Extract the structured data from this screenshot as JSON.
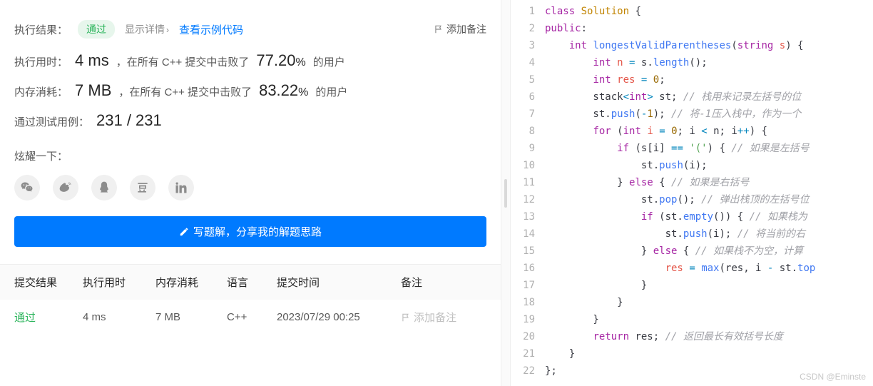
{
  "result": {
    "label": "执行结果：",
    "status": "通过",
    "show_detail": "显示详情",
    "view_example": "查看示例代码",
    "add_note": "添加备注"
  },
  "stats": {
    "time_label": "执行用时：",
    "time_value": "4 ms",
    "time_text1": "，在所有 C++ 提交中击败了",
    "time_pct": "77.20",
    "time_pct_sym": "%",
    "time_text2": "的用户",
    "mem_label": "内存消耗：",
    "mem_value": "7 MB",
    "mem_text1": "，在所有 C++ 提交中击败了",
    "mem_pct": "83.22",
    "mem_pct_sym": "%",
    "mem_text2": "的用户",
    "cases_label": "通过测试用例：",
    "cases_value": "231 / 231"
  },
  "share": {
    "label": "炫耀一下："
  },
  "button": {
    "write": "写题解，分享我的解题思路"
  },
  "table": {
    "headers": {
      "c1": "提交结果",
      "c2": "执行用时",
      "c3": "内存消耗",
      "c4": "语言",
      "c5": "提交时间",
      "c6": "备注"
    },
    "row": {
      "c1": "通过",
      "c2": "4 ms",
      "c3": "7 MB",
      "c4": "C++",
      "c5": "2023/07/29 00:25",
      "c6": "添加备注"
    }
  },
  "code": {
    "lines": [
      {
        "n": 1,
        "ind": 0,
        "tokens": [
          [
            "k-keyword",
            "class"
          ],
          [
            "",
            " "
          ],
          [
            "k-type",
            "Solution"
          ],
          [
            "",
            " {"
          ]
        ]
      },
      {
        "n": 2,
        "ind": 0,
        "tokens": [
          [
            "k-keyword",
            "public"
          ],
          [
            "",
            ":"
          ]
        ]
      },
      {
        "n": 3,
        "ind": 1,
        "tokens": [
          [
            "k-keyword",
            "int"
          ],
          [
            "",
            " "
          ],
          [
            "k-func",
            "longestValidParentheses"
          ],
          [
            "",
            "("
          ],
          [
            "k-keyword",
            "string"
          ],
          [
            "",
            " "
          ],
          [
            "k-ident",
            "s"
          ],
          [
            "",
            ") {"
          ]
        ]
      },
      {
        "n": 4,
        "ind": 2,
        "tokens": [
          [
            "k-keyword",
            "int"
          ],
          [
            "",
            " "
          ],
          [
            "k-ident",
            "n"
          ],
          [
            "",
            " "
          ],
          [
            "k-op",
            "="
          ],
          [
            "",
            " s."
          ],
          [
            "k-func",
            "length"
          ],
          [
            "",
            "();"
          ]
        ]
      },
      {
        "n": 5,
        "ind": 2,
        "tokens": [
          [
            "k-keyword",
            "int"
          ],
          [
            "",
            " "
          ],
          [
            "k-ident",
            "res"
          ],
          [
            "",
            " "
          ],
          [
            "k-op",
            "="
          ],
          [
            "",
            " "
          ],
          [
            "k-num",
            "0"
          ],
          [
            "",
            ";"
          ]
        ]
      },
      {
        "n": 6,
        "ind": 2,
        "tokens": [
          [
            "",
            "stack"
          ],
          [
            "k-op",
            "<"
          ],
          [
            "k-keyword",
            "int"
          ],
          [
            "k-op",
            ">"
          ],
          [
            "",
            " st; "
          ],
          [
            "k-comment",
            "// 栈用来记录左括号的位"
          ]
        ]
      },
      {
        "n": 7,
        "ind": 2,
        "tokens": [
          [
            "",
            "st."
          ],
          [
            "k-func",
            "push"
          ],
          [
            "",
            "("
          ],
          [
            "k-op",
            "-"
          ],
          [
            "k-num",
            "1"
          ],
          [
            "",
            "); "
          ],
          [
            "k-comment",
            "// 将-1压入栈中，作为一个"
          ]
        ]
      },
      {
        "n": 8,
        "ind": 2,
        "tokens": [
          [
            "k-keyword",
            "for"
          ],
          [
            "",
            " ("
          ],
          [
            "k-keyword",
            "int"
          ],
          [
            "",
            " "
          ],
          [
            "k-ident",
            "i"
          ],
          [
            "",
            " "
          ],
          [
            "k-op",
            "="
          ],
          [
            "",
            " "
          ],
          [
            "k-num",
            "0"
          ],
          [
            "",
            "; i "
          ],
          [
            "k-op",
            "<"
          ],
          [
            "",
            " n; i"
          ],
          [
            "k-op",
            "++"
          ],
          [
            "",
            ") {"
          ]
        ]
      },
      {
        "n": 9,
        "ind": 3,
        "tokens": [
          [
            "k-keyword",
            "if"
          ],
          [
            "",
            " (s[i] "
          ],
          [
            "k-op",
            "=="
          ],
          [
            "",
            " "
          ],
          [
            "k-str",
            "'('"
          ],
          [
            "",
            ") { "
          ],
          [
            "k-comment",
            "// 如果是左括号"
          ]
        ]
      },
      {
        "n": 10,
        "ind": 4,
        "tokens": [
          [
            "",
            "st."
          ],
          [
            "k-func",
            "push"
          ],
          [
            "",
            "(i);"
          ]
        ]
      },
      {
        "n": 11,
        "ind": 3,
        "tokens": [
          [
            "",
            "} "
          ],
          [
            "k-keyword",
            "else"
          ],
          [
            "",
            " { "
          ],
          [
            "k-comment",
            "// 如果是右括号"
          ]
        ]
      },
      {
        "n": 12,
        "ind": 4,
        "tokens": [
          [
            "",
            "st."
          ],
          [
            "k-func",
            "pop"
          ],
          [
            "",
            "(); "
          ],
          [
            "k-comment",
            "// 弹出栈顶的左括号位"
          ]
        ]
      },
      {
        "n": 13,
        "ind": 4,
        "tokens": [
          [
            "k-keyword",
            "if"
          ],
          [
            "",
            " (st."
          ],
          [
            "k-func",
            "empty"
          ],
          [
            "",
            "()) { "
          ],
          [
            "k-comment",
            "// 如果栈为"
          ]
        ]
      },
      {
        "n": 14,
        "ind": 5,
        "tokens": [
          [
            "",
            "st."
          ],
          [
            "k-func",
            "push"
          ],
          [
            "",
            "(i); "
          ],
          [
            "k-comment",
            "// 将当前的右"
          ]
        ]
      },
      {
        "n": 15,
        "ind": 4,
        "tokens": [
          [
            "",
            "} "
          ],
          [
            "k-keyword",
            "else"
          ],
          [
            "",
            " { "
          ],
          [
            "k-comment",
            "// 如果栈不为空，计算"
          ]
        ]
      },
      {
        "n": 16,
        "ind": 5,
        "tokens": [
          [
            "k-ident",
            "res"
          ],
          [
            "",
            " "
          ],
          [
            "k-op",
            "="
          ],
          [
            "",
            " "
          ],
          [
            "k-func",
            "max"
          ],
          [
            "",
            "(res, i "
          ],
          [
            "k-op",
            "-"
          ],
          [
            "",
            " st."
          ],
          [
            "k-func",
            "top"
          ]
        ]
      },
      {
        "n": 17,
        "ind": 4,
        "tokens": [
          [
            "",
            "}"
          ]
        ]
      },
      {
        "n": 18,
        "ind": 3,
        "tokens": [
          [
            "",
            "}"
          ]
        ]
      },
      {
        "n": 19,
        "ind": 2,
        "tokens": [
          [
            "",
            "}"
          ]
        ]
      },
      {
        "n": 20,
        "ind": 2,
        "tokens": [
          [
            "k-keyword",
            "return"
          ],
          [
            "",
            " res; "
          ],
          [
            "k-comment",
            "// 返回最长有效括号长度"
          ]
        ]
      },
      {
        "n": 21,
        "ind": 1,
        "tokens": [
          [
            "",
            "}"
          ]
        ]
      },
      {
        "n": 22,
        "ind": 0,
        "tokens": [
          [
            "",
            "};"
          ]
        ]
      }
    ]
  },
  "watermark": "CSDN @Eminste"
}
